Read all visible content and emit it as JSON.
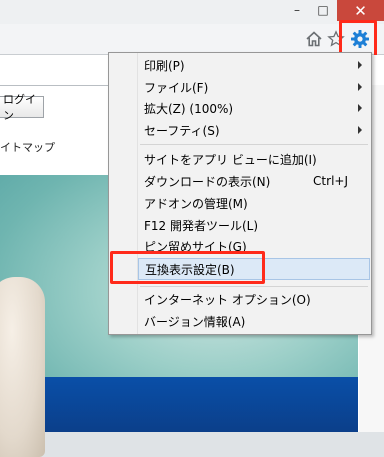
{
  "window": {
    "minimize": "–",
    "maximize": "□",
    "close": "✕"
  },
  "toolbar": {
    "icons": [
      "home-icon",
      "star-icon",
      "gear-icon"
    ],
    "accent": "#1e7fd6",
    "highlight_color": "#ff2a1a"
  },
  "page": {
    "login_label": "ログイン",
    "sitemap_label": "イトマップ"
  },
  "menu": {
    "items": [
      {
        "label": "印刷(P)",
        "submenu": true
      },
      {
        "label": "ファイル(F)",
        "submenu": true
      },
      {
        "label": "拡大(Z) (100%)",
        "submenu": true
      },
      {
        "label": "セーフティ(S)",
        "submenu": true
      },
      {
        "label": "サイトをアプリ ビューに追加(I)"
      },
      {
        "label": "ダウンロードの表示(N)",
        "shortcut": "Ctrl+J"
      },
      {
        "label": "アドオンの管理(M)"
      },
      {
        "label": "F12 開発者ツール(L)"
      },
      {
        "label": "ピン留めサイト(G)"
      },
      {
        "label": "互換表示設定(B)",
        "highlighted": true
      },
      {
        "label": "インターネット オプション(O)"
      },
      {
        "label": "バージョン情報(A)"
      }
    ]
  }
}
